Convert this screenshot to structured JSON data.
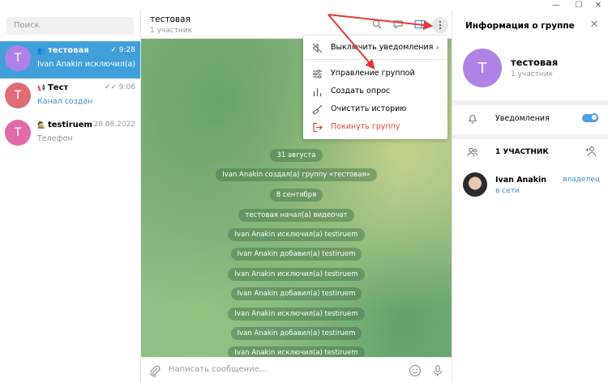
{
  "window": {
    "minimize": "—",
    "maximize": "☐",
    "close": "✕"
  },
  "search": {
    "placeholder": "Поиск"
  },
  "dialogs": [
    {
      "name": "тестовая",
      "type_icon": "group-icon",
      "time": "9:28",
      "message": "Ivan Anakin исключил(а) testiruem",
      "avatar_letter": "T",
      "avatar_color": "#b082e6",
      "active": true,
      "read": true
    },
    {
      "name": "Тест",
      "type_icon": "channel-icon",
      "time": "9:06",
      "message": "Канал создан",
      "avatar_letter": "T",
      "avatar_color": "#e06c75",
      "active": false,
      "read": true
    },
    {
      "name": "testiruem",
      "type_icon": "secret-chat-icon",
      "time": "28.08.2022",
      "message": "Телефон",
      "avatar_letter": "T",
      "avatar_color": "#e36aa8",
      "active": false,
      "read": false
    }
  ],
  "chat": {
    "title": "тестовая",
    "subtitle": "1 участник",
    "service_messages": [
      "31 августа",
      "Ivan Anakin создал(а) группу «тестовая»",
      "8 сентября",
      "тестовая начал(а) видеочат",
      "Ivan Anakin исключил(а) testiruem",
      "Ivan Anakin добавил(а) testiruem",
      "Ivan Anakin исключил(а) testiruem",
      "Ivan Anakin добавил(а) testiruem",
      "Ivan Anakin исключил(а) testiruem",
      "Ivan Anakin добавил(а) testiruem",
      "Ivan Anakin исключил(а) testiruem"
    ],
    "composer_placeholder": "Написать сообщение..."
  },
  "menu": {
    "items": [
      {
        "label": "Выключить уведомления",
        "icon": "mute-icon",
        "has_submenu": true
      },
      {
        "label": "Управление группой",
        "icon": "manage-icon"
      },
      {
        "label": "Создать опрос",
        "icon": "poll-icon"
      },
      {
        "label": "Очистить историю",
        "icon": "broom-icon"
      },
      {
        "label": "Покинуть группу",
        "icon": "leave-icon",
        "danger": true
      }
    ]
  },
  "info": {
    "title": "Информация о группе",
    "group_name": "тестовая",
    "group_subtitle": "1 участник",
    "avatar_letter": "T",
    "notifications_label": "Уведомления",
    "notifications_on": true,
    "members_header": "1 УЧАСТНИК",
    "member": {
      "name": "Ivan Anakin",
      "status": "в сети",
      "role": "владелец"
    }
  },
  "colors": {
    "accent": "#419fd9",
    "danger": "#e0483e",
    "annotation_arrow": "#e53935"
  }
}
